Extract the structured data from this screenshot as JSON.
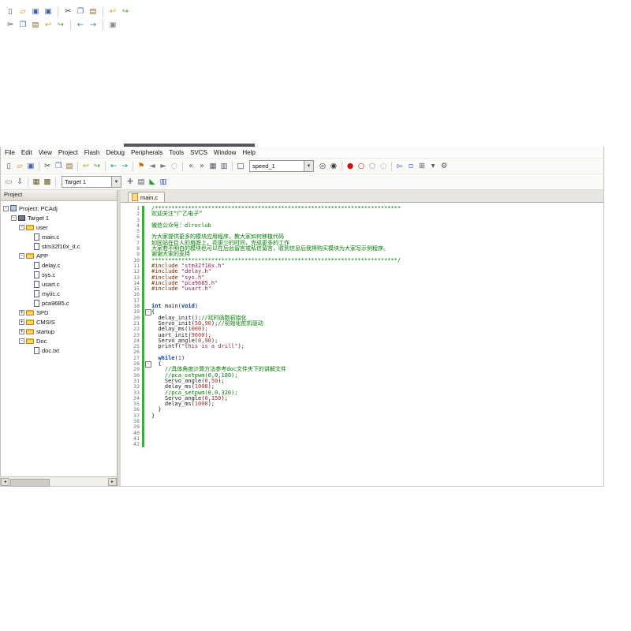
{
  "colors": {
    "comment_green": "#007d00",
    "change_bar_green": "#33b333",
    "keyword_blue": "#0541a5",
    "string_maroon": "#8b2252",
    "preprocessor_brown": "#7d2f00"
  },
  "top_fragment": {
    "row1": [
      {
        "name": "new-file",
        "glyph": "▯",
        "color": "#555555"
      },
      {
        "name": "open-folder",
        "glyph": "▱",
        "color": "#c8860a"
      },
      {
        "name": "save",
        "glyph": "▣",
        "color": "#3f5fae"
      },
      {
        "name": "save-all",
        "glyph": "▣",
        "color": "#3f5fae"
      },
      {
        "sep": true
      },
      {
        "name": "cut",
        "glyph": "✂",
        "color": "#333333"
      },
      {
        "name": "copy",
        "glyph": "❐",
        "color": "#3f5fae"
      },
      {
        "name": "paste",
        "glyph": "▤",
        "color": "#8a6a2f"
      },
      {
        "sep": true
      },
      {
        "name": "undo",
        "glyph": "↩",
        "color": "#c9a000"
      },
      {
        "name": "redo",
        "glyph": "↪",
        "color": "#3f9b41"
      }
    ],
    "row2": [
      {
        "name": "cut",
        "glyph": "✂",
        "color": "#333333"
      },
      {
        "name": "copy",
        "glyph": "❐",
        "color": "#3f5fae"
      },
      {
        "name": "paste",
        "glyph": "▤",
        "color": "#8a6a2f"
      },
      {
        "name": "undo",
        "glyph": "↩",
        "color": "#c9a000"
      },
      {
        "name": "redo",
        "glyph": "↪",
        "color": "#3f9b41"
      },
      {
        "sep": true
      },
      {
        "name": "navigate-back",
        "glyph": "←",
        "color": "#0d8f8f"
      },
      {
        "name": "navigate-forward",
        "glyph": "→",
        "color": "#0d8f8f"
      },
      {
        "sep": true
      },
      {
        "name": "bookmark-box",
        "glyph": "▣",
        "color": "#888888"
      }
    ]
  },
  "menu": {
    "items": [
      "File",
      "Edit",
      "View",
      "Project",
      "Flash",
      "Debug",
      "Peripherals",
      "Tools",
      "SVCS",
      "Window",
      "Help"
    ]
  },
  "toolbar1": {
    "combo_value": "speed_1",
    "left_icons": [
      {
        "name": "new-file",
        "glyph": "▯",
        "color": "#555555"
      },
      {
        "name": "open-folder",
        "glyph": "▱",
        "color": "#c8860a"
      },
      {
        "name": "save",
        "glyph": "▣",
        "color": "#3f5fae"
      },
      {
        "sep": true
      },
      {
        "name": "cut",
        "glyph": "✂",
        "color": "#333333"
      },
      {
        "name": "copy",
        "glyph": "❐",
        "color": "#3f5fae"
      },
      {
        "name": "paste",
        "glyph": "▤",
        "color": "#8a6a2f"
      },
      {
        "sep": true
      },
      {
        "name": "undo",
        "glyph": "↩",
        "color": "#c9a000"
      },
      {
        "name": "redo",
        "glyph": "↪",
        "color": "#3f9b41"
      },
      {
        "sep": true
      },
      {
        "name": "navigate-back",
        "glyph": "←",
        "color": "#0d8f8f"
      },
      {
        "name": "navigate-forward",
        "glyph": "→",
        "color": "#0d8f8f"
      },
      {
        "sep": true
      },
      {
        "name": "bookmark",
        "glyph": "⚑",
        "color": "#cc6600"
      },
      {
        "name": "previous-bookmark",
        "glyph": "◄",
        "color": "#777777"
      },
      {
        "name": "next-bookmark",
        "glyph": "►",
        "color": "#777777"
      },
      {
        "name": "clear-bookmarks",
        "glyph": "◌",
        "color": "#777777"
      },
      {
        "sep": true
      },
      {
        "name": "unindent",
        "glyph": "«",
        "color": "#555566"
      },
      {
        "name": "indent",
        "glyph": "»",
        "color": "#555566"
      },
      {
        "name": "comment-selection",
        "glyph": "▦",
        "color": "#555566"
      },
      {
        "name": "uncomment-selection",
        "glyph": "▥",
        "color": "#555566"
      },
      {
        "sep": true
      },
      {
        "name": "toolbar-checkbox",
        "glyph": "□",
        "color": "#333333"
      }
    ],
    "right_icons": [
      {
        "name": "find-in-files",
        "glyph": "◎",
        "color": "#333333"
      },
      {
        "name": "search",
        "glyph": "◉",
        "color": "#333333"
      },
      {
        "sep": true
      },
      {
        "name": "insert-breakpoint",
        "glyph": "●",
        "color": "#cc1111"
      },
      {
        "name": "toggle-breakpoint",
        "glyph": "○",
        "color": "#cc1111"
      },
      {
        "name": "disable-breakpoints",
        "glyph": "○",
        "color": "#888888"
      },
      {
        "name": "kill-breakpoints",
        "glyph": "◌",
        "color": "#888888"
      },
      {
        "sep": true
      },
      {
        "name": "debug-session",
        "glyph": "▻",
        "color": "#2a52b8"
      },
      {
        "name": "periodic-update",
        "glyph": "▫",
        "color": "#2a52b8"
      },
      {
        "name": "window-layout",
        "glyph": "⊞",
        "color": "#555566"
      },
      {
        "name": "layout-dropdown",
        "glyph": "▾",
        "color": "#555566"
      },
      {
        "name": "configure",
        "glyph": "⚙",
        "color": "#555555"
      }
    ]
  },
  "toolbar2": {
    "combo_value": "Target 1",
    "left_icons": [
      {
        "name": "flash-erase",
        "glyph": "▭",
        "color": "#777777"
      },
      {
        "name": "flash-download",
        "glyph": "⇩",
        "color": "#444444"
      },
      {
        "sep": true
      },
      {
        "name": "build",
        "glyph": "▦",
        "color": "#6a5a2a"
      },
      {
        "name": "rebuild",
        "glyph": "▩",
        "color": "#6a5a2a"
      },
      {
        "sep": true
      }
    ],
    "right_icons": [
      {
        "name": "target-options",
        "glyph": "✚",
        "color": "#888888"
      },
      {
        "name": "manage-items",
        "glyph": "▤",
        "color": "#555566"
      },
      {
        "name": "component-viewer",
        "glyph": "◣",
        "color": "#2a9d2a"
      },
      {
        "name": "books",
        "glyph": "▥",
        "color": "#3355aa"
      }
    ]
  },
  "project_panel": {
    "title": "Project",
    "tree": [
      {
        "label": "Project: PCAdj",
        "level": 0,
        "icon": "workspace",
        "exp": "minus"
      },
      {
        "label": "Target 1",
        "level": 1,
        "icon": "target",
        "exp": "minus"
      },
      {
        "label": "user",
        "level": 2,
        "icon": "folder",
        "exp": "minus"
      },
      {
        "label": "main.c",
        "level": 3,
        "icon": "cfile",
        "exp": "none"
      },
      {
        "label": "stm32f10x_it.c",
        "level": 3,
        "icon": "cfile",
        "exp": "none"
      },
      {
        "label": "APP",
        "level": 2,
        "icon": "folder",
        "exp": "minus"
      },
      {
        "label": "delay.c",
        "level": 3,
        "icon": "cfile",
        "exp": "none"
      },
      {
        "label": "sys.c",
        "level": 3,
        "icon": "cfile",
        "exp": "none"
      },
      {
        "label": "usart.c",
        "level": 3,
        "icon": "cfile",
        "exp": "none"
      },
      {
        "label": "myiic.c",
        "level": 3,
        "icon": "cfile",
        "exp": "none"
      },
      {
        "label": "pca9685.c",
        "level": 3,
        "icon": "cfile",
        "exp": "none"
      },
      {
        "label": "SPD",
        "level": 2,
        "icon": "folder",
        "exp": "plus"
      },
      {
        "label": "CMSIS",
        "level": 2,
        "icon": "folder",
        "exp": "plus"
      },
      {
        "label": "startup",
        "level": 2,
        "icon": "folder",
        "exp": "plus"
      },
      {
        "label": "Doc",
        "level": 2,
        "icon": "folder",
        "exp": "minus"
      },
      {
        "label": "doc.txt",
        "level": 3,
        "icon": "file",
        "exp": "none"
      }
    ]
  },
  "editor": {
    "tab_label": "main.c",
    "lines": [
      {
        "n": 1,
        "segs": [
          [
            "cm",
            "/**************************************************************************"
          ]
        ]
      },
      {
        "n": 2,
        "segs": [
          [
            "cm",
            "欢迎关注“广乙电子”"
          ]
        ]
      },
      {
        "n": 3,
        "segs": []
      },
      {
        "n": 4,
        "segs": [
          [
            "cm",
            "微信公众号：dlroclub"
          ]
        ]
      },
      {
        "n": 5,
        "segs": []
      },
      {
        "n": 6,
        "segs": [
          [
            "cm",
            "为大家提供更多的模块应用程序，教大家如何移植代码"
          ]
        ]
      },
      {
        "n": 7,
        "segs": [
          [
            "cm",
            "如同站在巨人的肩膀上，花更少的时间，完成更多的工作"
          ]
        ]
      },
      {
        "n": 8,
        "segs": [
          [
            "cm",
            "大家若不明白的模块也可以在后台留言或私信留言，收到信息后我将购买模块为大家写示例程序。"
          ]
        ]
      },
      {
        "n": 9,
        "segs": [
          [
            "cm",
            "谢谢大家的支持"
          ]
        ]
      },
      {
        "n": 10,
        "segs": [
          [
            "cm",
            "**************************************************************************/"
          ]
        ]
      },
      {
        "n": 11,
        "segs": [
          [
            "pp",
            "#include "
          ],
          [
            "str",
            "\"stm32f10x.h\""
          ]
        ]
      },
      {
        "n": 12,
        "segs": [
          [
            "pp",
            "#include "
          ],
          [
            "str",
            "\"delay.h\""
          ]
        ]
      },
      {
        "n": 13,
        "segs": [
          [
            "pp",
            "#include "
          ],
          [
            "str",
            "\"sys.h\""
          ]
        ]
      },
      {
        "n": 14,
        "segs": [
          [
            "pp",
            "#include "
          ],
          [
            "str",
            "\"pca9685.h\""
          ]
        ]
      },
      {
        "n": 15,
        "segs": [
          [
            "pp",
            "#include "
          ],
          [
            "str",
            "\"usart.h\""
          ]
        ]
      },
      {
        "n": 16,
        "segs": []
      },
      {
        "n": 17,
        "segs": []
      },
      {
        "n": 18,
        "segs": [
          [
            "kw",
            "int"
          ],
          [
            "pl",
            " main("
          ],
          [
            "kw",
            "void"
          ],
          [
            "pl",
            ")"
          ]
        ]
      },
      {
        "n": 19,
        "fold": true,
        "segs": [
          [
            "pl",
            "{"
          ]
        ]
      },
      {
        "n": 20,
        "segs": [
          [
            "pl",
            "  delay_init();"
          ],
          [
            "cm",
            "//延时函数初始化"
          ]
        ]
      },
      {
        "n": 21,
        "segs": [
          [
            "pl",
            "  Servo_init("
          ],
          [
            "num",
            "50"
          ],
          [
            "pl",
            ","
          ],
          [
            "num",
            "90"
          ],
          [
            "pl",
            ");"
          ],
          [
            "cm",
            "//初始化舵机驱动"
          ]
        ]
      },
      {
        "n": 22,
        "segs": [
          [
            "pl",
            "  delay_ms("
          ],
          [
            "num",
            "1000"
          ],
          [
            "pl",
            ");"
          ]
        ]
      },
      {
        "n": 23,
        "segs": [
          [
            "pl",
            "  uart_init("
          ],
          [
            "num",
            "9600"
          ],
          [
            "pl",
            ");"
          ]
        ]
      },
      {
        "n": 24,
        "segs": [
          [
            "pl",
            "  Servo_angle("
          ],
          [
            "num",
            "0"
          ],
          [
            "pl",
            ","
          ],
          [
            "num",
            "90"
          ],
          [
            "pl",
            ");"
          ]
        ]
      },
      {
        "n": 25,
        "segs": [
          [
            "pl",
            "  printf("
          ],
          [
            "str",
            "\"this is a drill\""
          ],
          [
            "pl",
            ");"
          ]
        ]
      },
      {
        "n": 26,
        "segs": []
      },
      {
        "n": 27,
        "segs": [
          [
            "pl",
            "  "
          ],
          [
            "kw",
            "while"
          ],
          [
            "pl",
            "("
          ],
          [
            "num",
            "1"
          ],
          [
            "pl",
            ")"
          ]
        ]
      },
      {
        "n": 28,
        "fold": true,
        "segs": [
          [
            "pl",
            "  {"
          ]
        ]
      },
      {
        "n": 29,
        "segs": [
          [
            "cm",
            "    //具体角度计算方法参考doc文件夹下的讲解文件"
          ]
        ]
      },
      {
        "n": 30,
        "segs": [
          [
            "cm",
            "    //pca_setpwm(0,0,180);"
          ]
        ]
      },
      {
        "n": 31,
        "segs": [
          [
            "pl",
            "    Servo_angle("
          ],
          [
            "num",
            "0"
          ],
          [
            "pl",
            ","
          ],
          [
            "num",
            "50"
          ],
          [
            "pl",
            ");"
          ]
        ]
      },
      {
        "n": 32,
        "segs": [
          [
            "pl",
            "    delay_ms("
          ],
          [
            "num",
            "1000"
          ],
          [
            "pl",
            ");"
          ]
        ]
      },
      {
        "n": 33,
        "segs": [
          [
            "cm",
            "    //pca_setpwm(0,0,320);"
          ]
        ]
      },
      {
        "n": 34,
        "segs": [
          [
            "pl",
            "    Servo_angle("
          ],
          [
            "num",
            "0"
          ],
          [
            "pl",
            ","
          ],
          [
            "num",
            "150"
          ],
          [
            "pl",
            ");"
          ]
        ]
      },
      {
        "n": 35,
        "segs": [
          [
            "pl",
            "    delay_ms("
          ],
          [
            "num",
            "1000"
          ],
          [
            "pl",
            ");"
          ]
        ]
      },
      {
        "n": 36,
        "segs": [
          [
            "pl",
            "  }"
          ]
        ]
      },
      {
        "n": 37,
        "segs": [
          [
            "pl",
            "}"
          ]
        ]
      },
      {
        "n": 38,
        "segs": []
      },
      {
        "n": 39,
        "segs": []
      },
      {
        "n": 40,
        "segs": []
      },
      {
        "n": 41,
        "segs": []
      },
      {
        "n": 42,
        "segs": []
      }
    ]
  }
}
